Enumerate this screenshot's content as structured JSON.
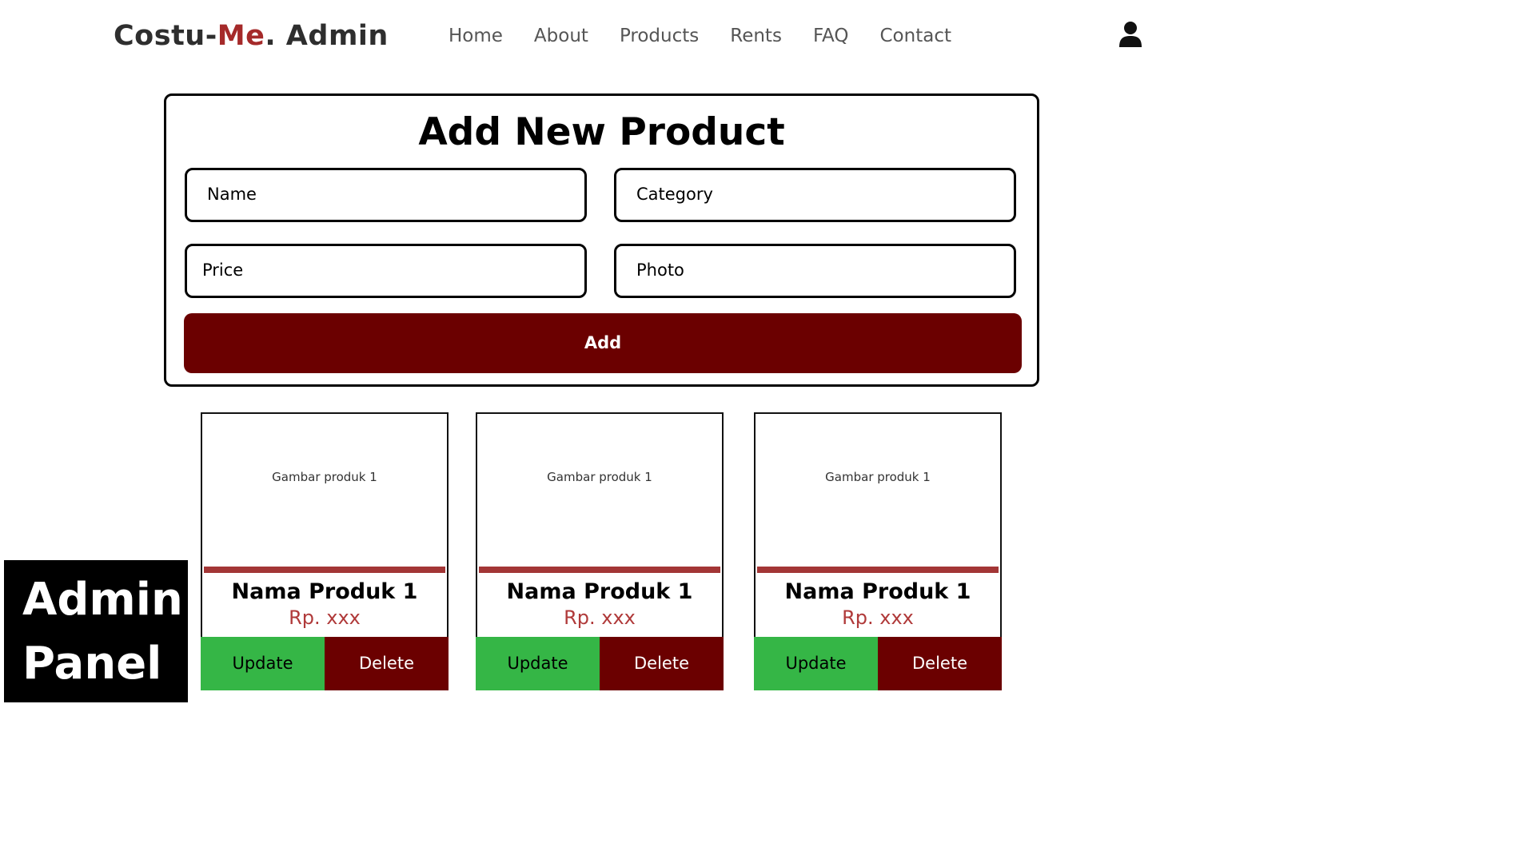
{
  "header": {
    "brand_part1": "Costu-",
    "brand_part2": "Me",
    "brand_part3": ". Admin",
    "nav": [
      "Home",
      "About",
      "Products",
      "Rents",
      "FAQ",
      "Contact"
    ],
    "user_icon": "user-icon"
  },
  "form": {
    "title": "Add New Product",
    "name_placeholder": "Name",
    "category_placeholder": "Category",
    "price_placeholder": "Price",
    "photo_placeholder": "Photo",
    "add_label": "Add"
  },
  "products": [
    {
      "image_label": "Gambar produk 1",
      "name": "Nama Produk 1",
      "price": "Rp. xxx",
      "update_label": "Update",
      "delete_label": "Delete"
    },
    {
      "image_label": "Gambar produk 1",
      "name": "Nama Produk 1",
      "price": "Rp. xxx",
      "update_label": "Update",
      "delete_label": "Delete"
    },
    {
      "image_label": "Gambar produk 1",
      "name": "Nama Produk 1",
      "price": "Rp. xxx",
      "update_label": "Update",
      "delete_label": "Delete"
    }
  ],
  "badge": {
    "line1": "Admin",
    "line2": "Panel"
  },
  "colors": {
    "brand_accent": "#a52a2a",
    "primary_dark_red": "#6b0000",
    "update_green": "#35b646",
    "price_red": "#b03a3a"
  }
}
